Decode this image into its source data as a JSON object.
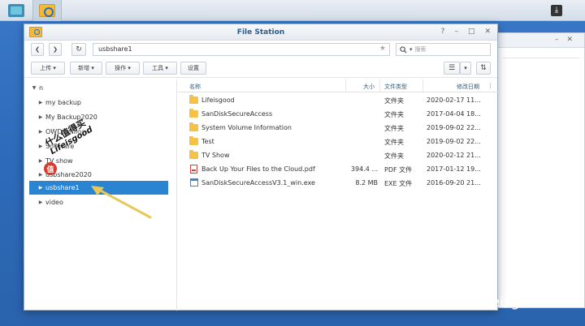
{
  "window": {
    "title": "File Station",
    "controls": [
      "?",
      "–",
      "□",
      "✕"
    ]
  },
  "nav": {
    "back": "❮",
    "forward": "❯",
    "refresh": "↻",
    "path": "usbshare1",
    "star": "★",
    "search_placeholder": "搜索"
  },
  "toolbar": {
    "upload": "上传 ▾",
    "create": "新增 ▾",
    "action": "操作 ▾",
    "tools": "工具 ▾",
    "settings": "设置",
    "view_list": "☰",
    "view_dropdown": "▾",
    "sort": "⇅"
  },
  "tree": {
    "root": "n",
    "items": [
      {
        "label": "my backup"
      },
      {
        "label": "My Backup2020"
      },
      {
        "label": "OWDownload"
      },
      {
        "label": "Software"
      },
      {
        "label": "TV show"
      },
      {
        "label": "usbshare2020"
      },
      {
        "label": "usbshare1"
      },
      {
        "label": "video"
      }
    ]
  },
  "list": {
    "headers": {
      "name": "名称",
      "size": "大小",
      "type": "文件类型",
      "modified": "修改日期",
      "more": "⋮",
      "sort_indicator": "▾"
    },
    "rows": [
      {
        "name": "Lifeisgood",
        "size": "",
        "type": "文件夹",
        "modified": "2020-02-17 11...",
        "icon": "folder-icon"
      },
      {
        "name": "SanDiskSecureAccess",
        "size": "",
        "type": "文件夹",
        "modified": "2017-04-04 18...",
        "icon": "folder-icon"
      },
      {
        "name": "System Volume Information",
        "size": "",
        "type": "文件夹",
        "modified": "2019-09-02 22...",
        "icon": "folder-icon"
      },
      {
        "name": "Test",
        "size": "",
        "type": "文件夹",
        "modified": "2019-09-02 22...",
        "icon": "folder-icon"
      },
      {
        "name": "TV Show",
        "size": "",
        "type": "文件夹",
        "modified": "2020-02-12 21...",
        "icon": "folder-icon"
      },
      {
        "name": "Back Up Your Files to the Cloud.pdf",
        "size": "394.4 ...",
        "type": "PDF 文件",
        "modified": "2017-01-12 19...",
        "icon": "pdf-file-icon"
      },
      {
        "name": "SanDiskSecureAccessV3.1_win.exe",
        "size": "8.2 MB",
        "type": "EXE 文件",
        "modified": "2016-09-20 21...",
        "icon": "exe-file-icon"
      }
    ]
  },
  "watermark": {
    "badge": "值",
    "site": "什么值得买",
    "user": "Lifeisgood",
    "zhihu": "知乎 @Lifeisgood"
  },
  "taskbar": {
    "download_icon": "⤓"
  },
  "colors": {
    "desktop": "#2d6ab8",
    "selection": "#2a84d2",
    "folder": "#f5c146",
    "accent_text": "#2a5d8f"
  }
}
